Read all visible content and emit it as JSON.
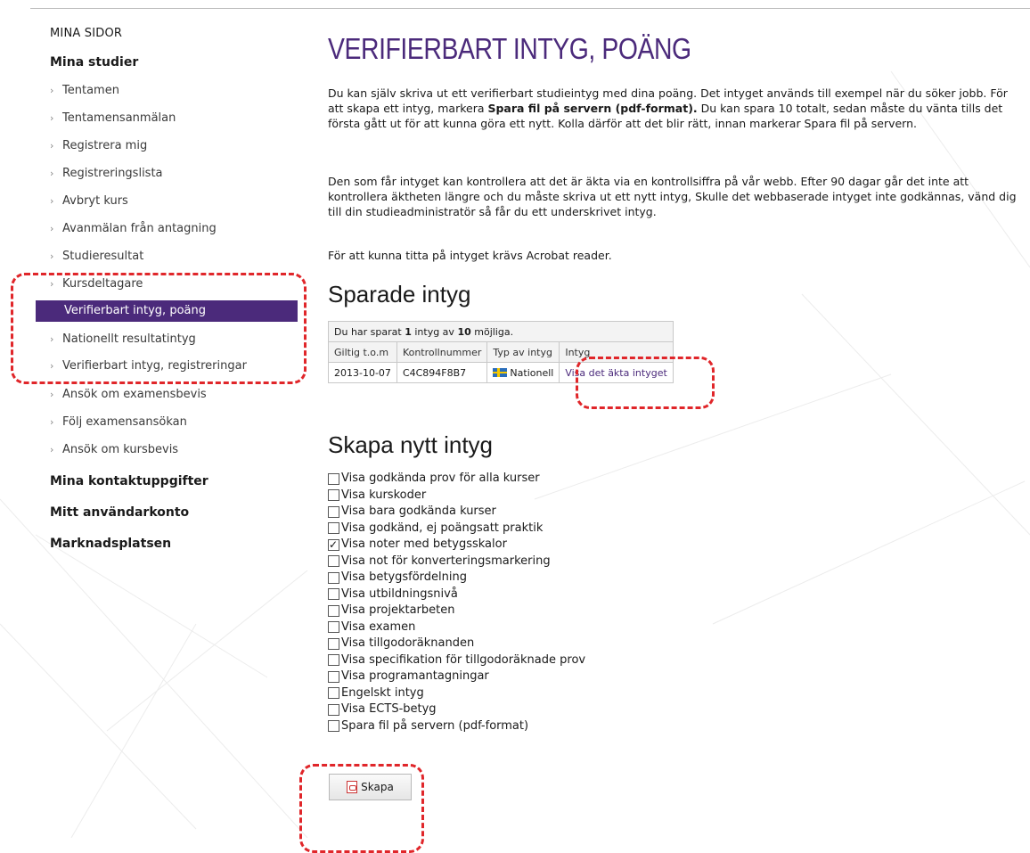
{
  "sidebar": {
    "header": "MINA SIDOR",
    "section_studies": "Mina studier",
    "items": [
      {
        "label": "Tentamen"
      },
      {
        "label": "Tentamensanmälan"
      },
      {
        "label": "Registrera mig"
      },
      {
        "label": "Registreringslista"
      },
      {
        "label": "Avbryt kurs"
      },
      {
        "label": "Avanmälan från antagning"
      },
      {
        "label": "Studieresultat"
      },
      {
        "label": "Kursdeltagare"
      },
      {
        "label": "Verifierbart intyg, poäng"
      },
      {
        "label": "Nationellt resultatintyg"
      },
      {
        "label": "Verifierbart intyg, registreringar"
      },
      {
        "label": "Ansök om examensbevis"
      },
      {
        "label": "Följ examensansökan"
      },
      {
        "label": "Ansök om kursbevis"
      }
    ],
    "section_contact": "Mina kontaktuppgifter",
    "section_account": "Mitt användarkonto",
    "section_market": "Marknadsplatsen"
  },
  "main": {
    "title": "VERIFIERBART INTYG, POÄNG",
    "p1_a": "Du kan själv skriva ut ett verifierbart studieintyg med dina poäng. Det intyget används till exempel när du söker jobb. För att skapa ett intyg, markera ",
    "p1_bold": "Spara fil på servern (pdf-format).",
    "p1_b": " Du kan spara 10 totalt, sedan måste du vänta tills det första gått ut för att kunna göra ett nytt. Kolla därför att det blir rätt, innan markerar Spara fil på servern.",
    "p2": "Den som får intyget kan kontrollera att det är äkta via en kontrollsiffra på vår webb. Efter 90 dagar går det inte att kontrollera äktheten längre och du måste skriva ut ett nytt intyg, Skulle det webbaserade intyget inte godkännas, vänd dig till din studieadministratör så får du ett underskrivet intyg.",
    "p3": "För att kunna titta på intyget krävs Acrobat reader.",
    "saved_heading": "Sparade intyg",
    "saved_info_a": "Du har sparat ",
    "saved_info_count": "1",
    "saved_info_b": " intyg av ",
    "saved_info_max": "10",
    "saved_info_c": " möjliga.",
    "table_headers": {
      "valid": "Giltig t.o.m",
      "control": "Kontrollnummer",
      "type": "Typ av intyg",
      "cert": "Intyg"
    },
    "row": {
      "valid": "2013-10-07",
      "control": "C4C894F8B7",
      "type": "Nationell",
      "link": "Visa det äkta intyget"
    },
    "create_heading": "Skapa nytt intyg",
    "options": [
      {
        "label": "Visa godkända prov för alla kurser",
        "checked": false
      },
      {
        "label": "Visa kurskoder",
        "checked": false
      },
      {
        "label": "Visa bara godkända kurser",
        "checked": false
      },
      {
        "label": "Visa godkänd, ej poängsatt praktik",
        "checked": false
      },
      {
        "label": "Visa noter med betygsskalor",
        "checked": true
      },
      {
        "label": "Visa not för konverteringsmarkering",
        "checked": false
      },
      {
        "label": "Visa betygsfördelning",
        "checked": false
      },
      {
        "label": "Visa utbildningsnivå",
        "checked": false
      },
      {
        "label": "Visa projektarbeten",
        "checked": false
      },
      {
        "label": "Visa examen",
        "checked": false
      },
      {
        "label": "Visa tillgodoräknanden",
        "checked": false
      },
      {
        "label": "Visa specifikation för tillgodoräknade prov",
        "checked": false
      },
      {
        "label": "Visa programantagningar",
        "checked": false
      },
      {
        "label": "Engelskt intyg",
        "checked": false
      },
      {
        "label": "Visa ECTS-betyg",
        "checked": false
      },
      {
        "label": "Spara fil på servern (pdf-format)",
        "checked": false
      }
    ],
    "create_button": "Skapa"
  },
  "colors": {
    "accent": "#4b2a7b",
    "annotation": "#e0262a"
  }
}
